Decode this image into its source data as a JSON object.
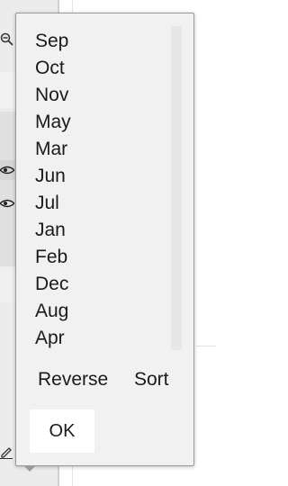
{
  "popup": {
    "items": [
      "Sep",
      "Oct",
      "Nov",
      "May",
      "Mar",
      "Jun",
      "Jul",
      "Jan",
      "Feb",
      "Dec",
      "Aug",
      "Apr"
    ],
    "reverse_label": "Reverse",
    "sort_label": "Sort",
    "ok_label": "OK"
  },
  "icons": {
    "zoom_out": "zoom-out-icon",
    "visibility_1": "eye-icon",
    "visibility_2": "eye-icon",
    "edit": "pencil-icon"
  }
}
